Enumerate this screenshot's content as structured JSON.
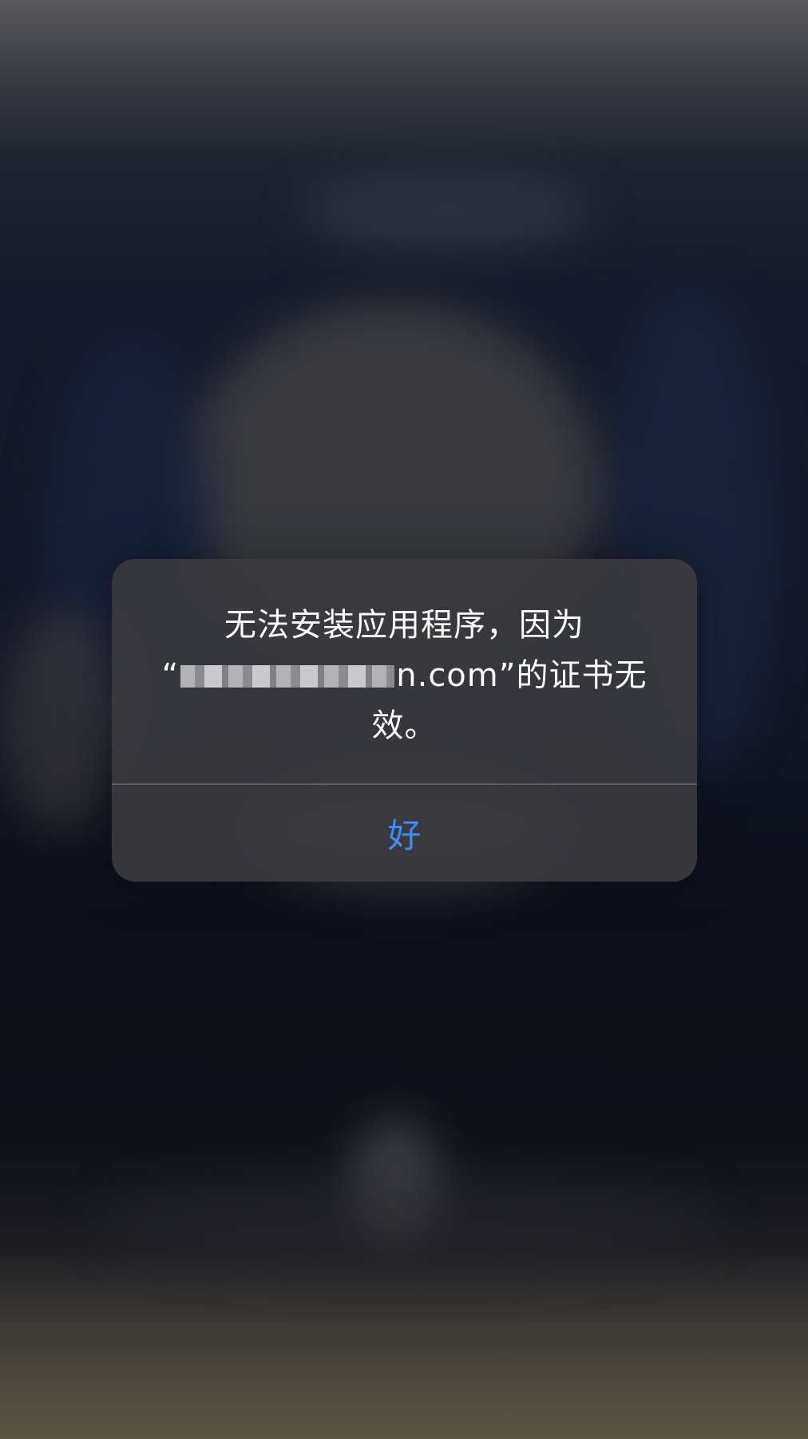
{
  "alert": {
    "message_line1": "无法安装应用程序，因为",
    "message_open_quote": "“",
    "message_domain_suffix": "n.com",
    "message_line2_rest": "”的证书无",
    "message_line3": "效。",
    "ok_button_label": "好"
  },
  "colors": {
    "button_text": "#3d8ef7",
    "alert_background": "#3a3a3e",
    "message_text": "#ffffff"
  }
}
